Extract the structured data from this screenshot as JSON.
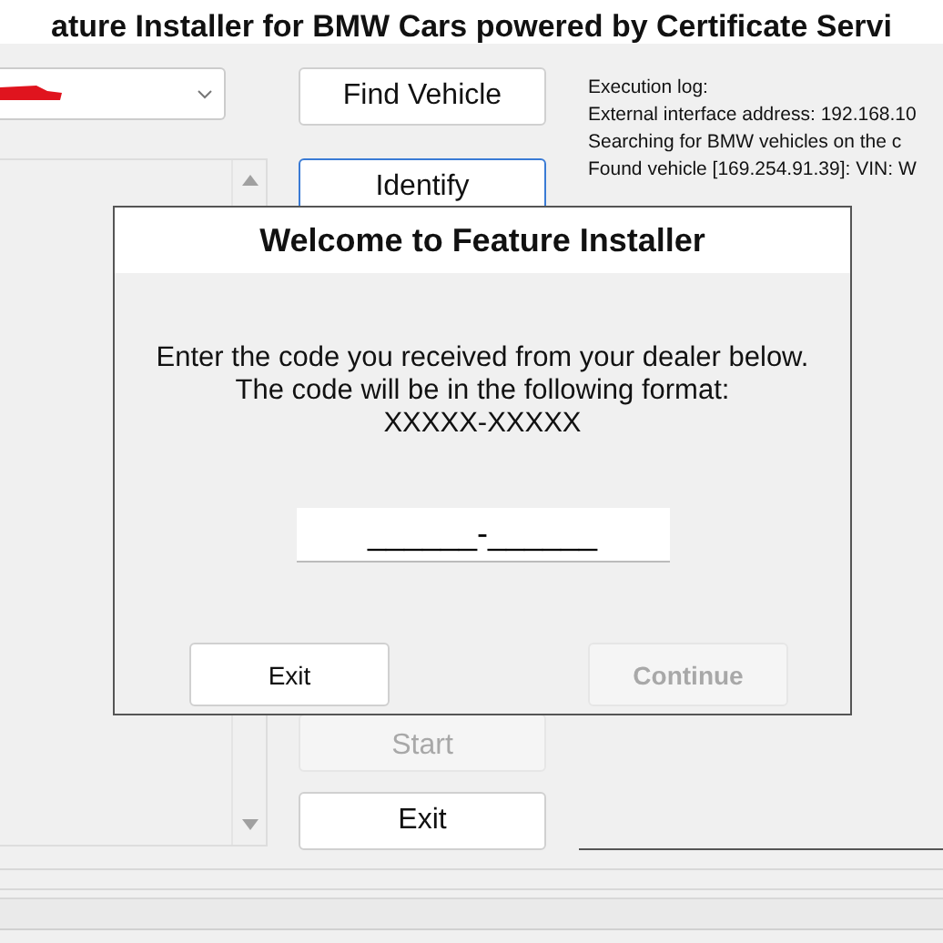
{
  "window": {
    "title": "ature Installer for BMW Cars powered by Certificate Servi"
  },
  "actions": [
    {
      "label": "Find Vehicle",
      "disabled": false,
      "focused": false
    },
    {
      "label": "Identify",
      "disabled": false,
      "focused": true
    },
    {
      "label": "Start",
      "disabled": true,
      "focused": false
    },
    {
      "label": "Exit",
      "disabled": false,
      "focused": false
    }
  ],
  "log": {
    "heading": "Execution log:",
    "lines": [
      "External interface address: 192.168.10",
      "Searching for BMW vehicles on the c",
      "Found vehicle [169.254.91.39]: VIN: W"
    ]
  },
  "dialog": {
    "title": "Welcome to Feature Installer",
    "message": [
      "Enter the code you received from your dealer below.",
      "The code will be in the following format:",
      "XXXXX-XXXXX"
    ],
    "code_field": {
      "value": "______-______"
    },
    "buttons": [
      {
        "label": "Exit",
        "disabled": false
      },
      {
        "label": "Continue",
        "disabled": true
      }
    ]
  }
}
